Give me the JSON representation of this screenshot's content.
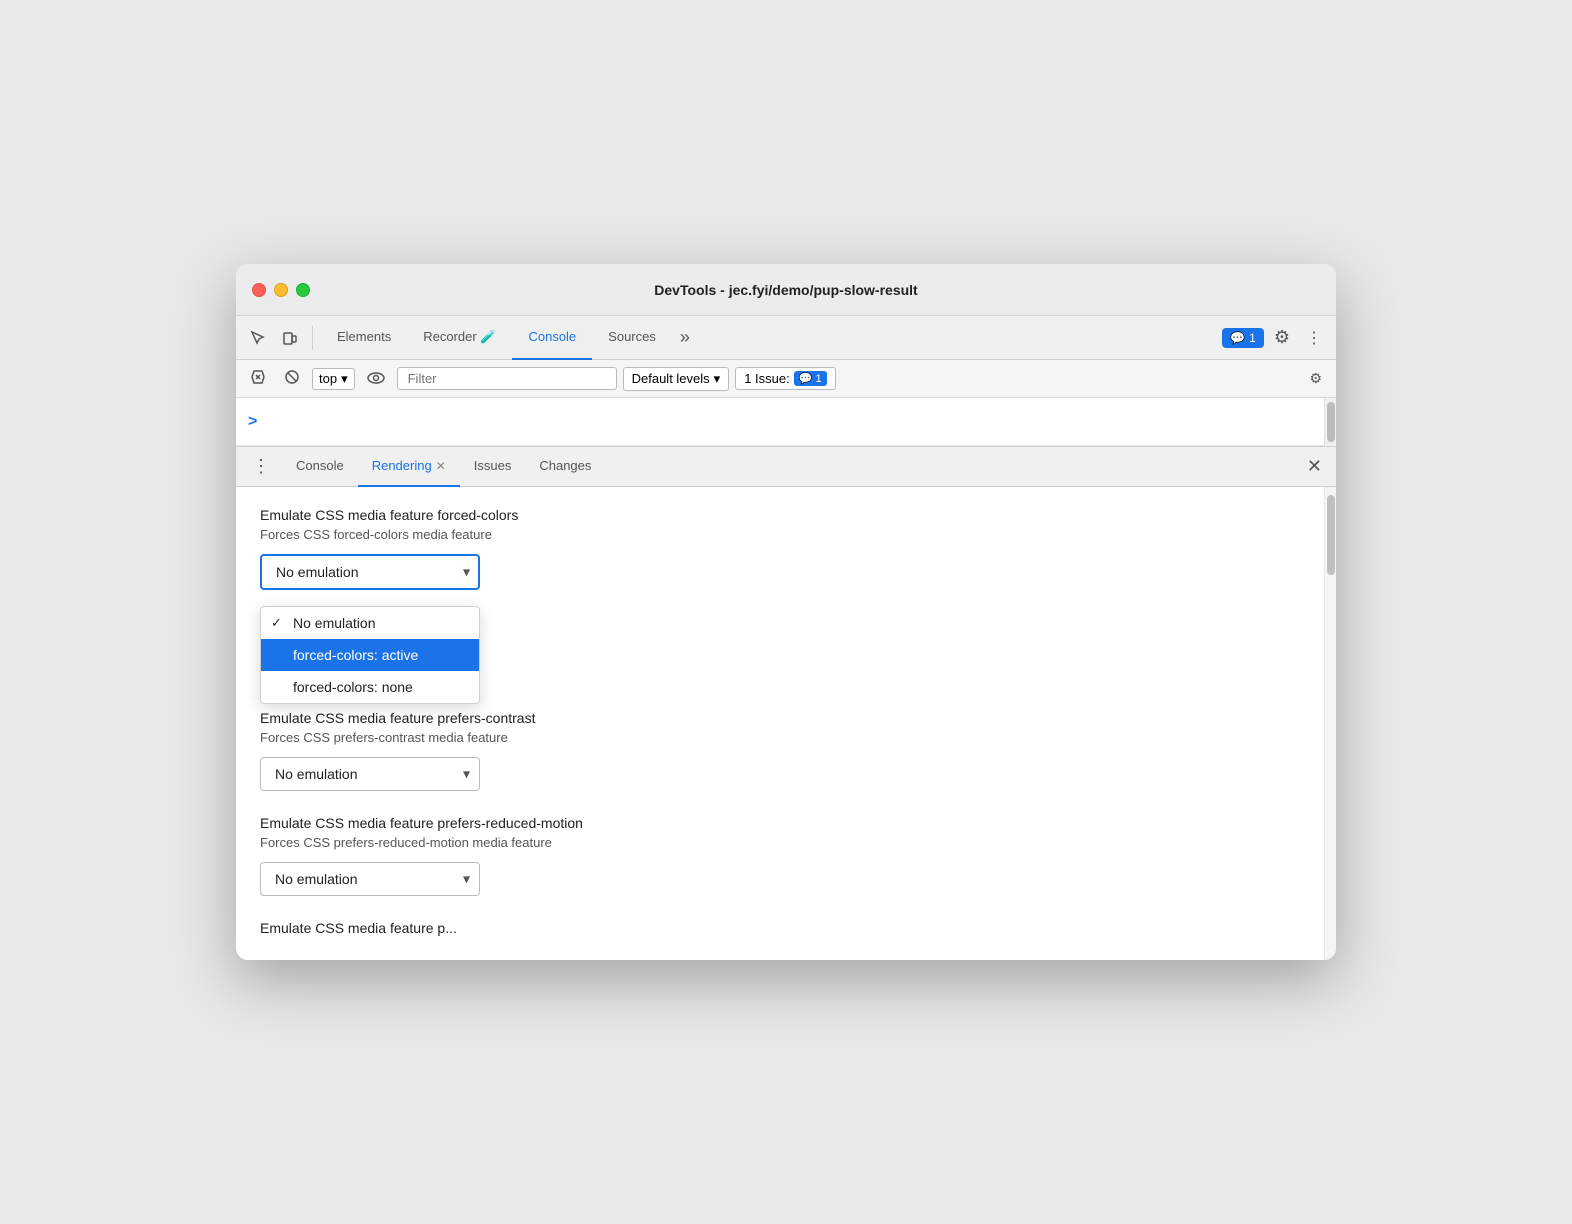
{
  "window": {
    "title": "DevTools - jec.fyi/demo/pup-slow-result"
  },
  "titlebar": {
    "title": "DevTools - jec.fyi/demo/pup-slow-result"
  },
  "top_toolbar": {
    "tabs": [
      {
        "label": "Elements",
        "active": false
      },
      {
        "label": "Recorder 🧪",
        "active": false
      },
      {
        "label": "Console",
        "active": true
      },
      {
        "label": "Sources",
        "active": false
      }
    ],
    "more_label": "»",
    "badge_count": "1",
    "gear_label": "⚙",
    "more_icon": "⋮"
  },
  "console_toolbar": {
    "top_label": "top",
    "filter_placeholder": "Filter",
    "default_levels_label": "Default levels",
    "issues_label": "1 Issue:",
    "issues_count": "1"
  },
  "console_prompt": {
    "symbol": ">"
  },
  "panel_tabs": {
    "more_label": "⋮",
    "tabs": [
      {
        "label": "Console",
        "active": false,
        "closeable": false
      },
      {
        "label": "Rendering",
        "active": true,
        "closeable": true
      },
      {
        "label": "Issues",
        "active": false,
        "closeable": false
      },
      {
        "label": "Changes",
        "active": false,
        "closeable": false
      }
    ],
    "close_label": "✕"
  },
  "rendering": {
    "forced_colors": {
      "title": "Emulate CSS media feature forced-colors",
      "desc": "Forces CSS forced-colors media feature",
      "select_value": "No emulation",
      "dropdown_open": true,
      "dropdown_options": [
        {
          "label": "No emulation",
          "checked": true,
          "selected": false
        },
        {
          "label": "forced-colors: active",
          "checked": false,
          "selected": true
        },
        {
          "label": "forced-colors: none",
          "checked": false,
          "selected": false
        }
      ]
    },
    "prefers_contrast": {
      "title": "Emulate CSS media feature prefers-contrast",
      "desc_partial": "st media feature",
      "select_value": "No emulation"
    },
    "prefers_reduced_motion": {
      "title": "Emulate CSS media feature prefers-reduced-motion",
      "desc": "Forces CSS prefers-reduced-motion media feature",
      "select_value": "No emulation"
    },
    "bottom_partial": "Emulate CSS media feature p..."
  }
}
